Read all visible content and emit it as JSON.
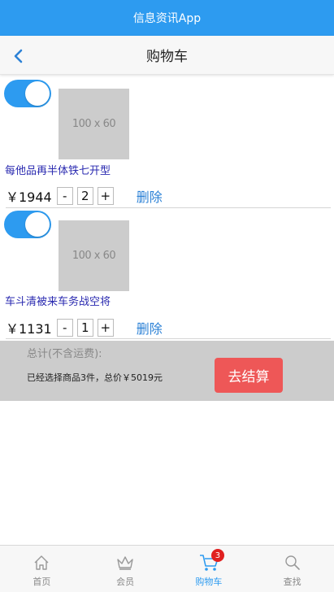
{
  "app_bar": {
    "title": "信息资讯App"
  },
  "nav": {
    "title": "购物车"
  },
  "cart": {
    "items": [
      {
        "enabled": true,
        "thumb_label": "100 x 60",
        "title": "每他品再半体铁七开型",
        "price": "￥1944",
        "qty_minus": "-",
        "qty": "2",
        "qty_plus": "+",
        "delete_label": "删除"
      },
      {
        "enabled": true,
        "thumb_label": "100 x 60",
        "title": "车斗清被来车务战空将",
        "price": "￥1131",
        "qty_minus": "-",
        "qty": "1",
        "qty_plus": "+",
        "delete_label": "删除"
      }
    ]
  },
  "summary": {
    "label": "总计(不含运费):",
    "text": "已经选择商品3件，总价￥5019元",
    "checkout_label": "去结算"
  },
  "tabs": [
    {
      "label": "首页",
      "icon": "home-icon",
      "active": false
    },
    {
      "label": "会员",
      "icon": "crown-icon",
      "active": false
    },
    {
      "label": "购物车",
      "icon": "cart-icon",
      "active": true,
      "badge": "3"
    },
    {
      "label": "查找",
      "icon": "search-icon",
      "active": false
    }
  ],
  "colors": {
    "primary": "#2d9bf0",
    "checkout": "#ee5757",
    "badge": "#e02020",
    "title_text": "#2a2ab0"
  }
}
